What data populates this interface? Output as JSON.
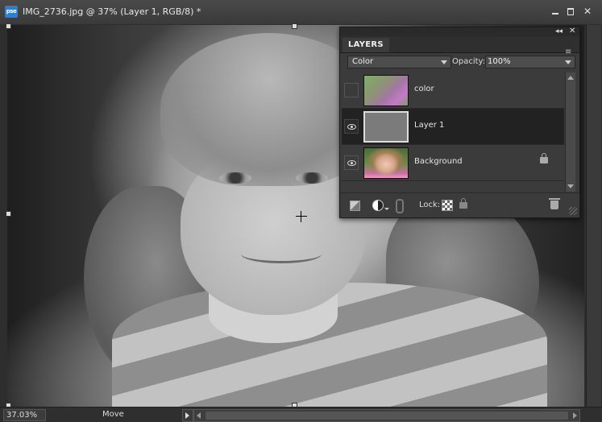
{
  "window": {
    "app_icon_text": "pse",
    "title": "IMG_2736.jpg @ 37% (Layer 1, RGB/8) *"
  },
  "layers_panel": {
    "tab_label": "LAYERS",
    "blend_mode": "Color",
    "opacity_label": "Opacity:",
    "opacity_value": "100%",
    "lock_label": "Lock:",
    "layers": [
      {
        "name": "color",
        "visible": false,
        "selected": false,
        "locked": false
      },
      {
        "name": "Layer 1",
        "visible": true,
        "selected": true,
        "locked": false
      },
      {
        "name": "Background",
        "visible": true,
        "selected": false,
        "locked": true
      }
    ]
  },
  "statusbar": {
    "zoom": "37.03%",
    "status_text": "Move"
  },
  "colors": {
    "panel_bg": "#3b3b3b",
    "selected_row": "#222222",
    "app_icon": "#2f7fd1"
  }
}
